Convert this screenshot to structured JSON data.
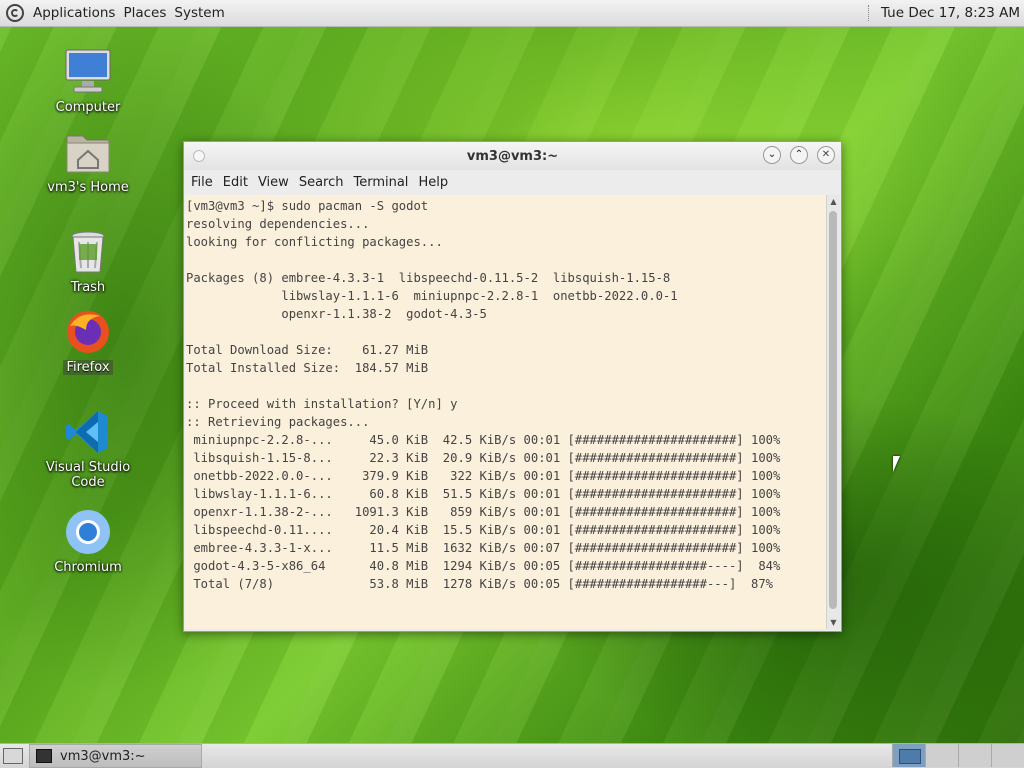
{
  "top_panel": {
    "menus": [
      "Applications",
      "Places",
      "System"
    ],
    "clock": "Tue Dec 17,  8:23 AM"
  },
  "desktop_icons": [
    {
      "label": "Computer",
      "icon": "computer-icon"
    },
    {
      "label": "vm3's Home",
      "icon": "home-folder-icon"
    },
    {
      "label": "Trash",
      "icon": "trash-icon"
    },
    {
      "label": "Firefox",
      "icon": "firefox-icon",
      "selected": true
    },
    {
      "label": "Visual Studio Code",
      "icon": "vscode-icon"
    },
    {
      "label": "Chromium",
      "icon": "chromium-icon"
    }
  ],
  "window": {
    "title": "vm3@vm3:~",
    "menus": [
      "File",
      "Edit",
      "View",
      "Search",
      "Terminal",
      "Help"
    ],
    "terminal_lines": [
      "[vm3@vm3 ~]$ sudo pacman -S godot",
      "resolving dependencies...",
      "looking for conflicting packages...",
      "",
      "Packages (8) embree-4.3.3-1  libspeechd-0.11.5-2  libsquish-1.15-8",
      "             libwslay-1.1.1-6  miniupnpc-2.2.8-1  onetbb-2022.0.0-1",
      "             openxr-1.1.38-2  godot-4.3-5",
      "",
      "Total Download Size:    61.27 MiB",
      "Total Installed Size:  184.57 MiB",
      "",
      ":: Proceed with installation? [Y/n] y",
      ":: Retrieving packages...",
      " miniupnpc-2.2.8-...     45.0 KiB  42.5 KiB/s 00:01 [######################] 100%",
      " libsquish-1.15-8...     22.3 KiB  20.9 KiB/s 00:01 [######################] 100%",
      " onetbb-2022.0.0-...    379.9 KiB   322 KiB/s 00:01 [######################] 100%",
      " libwslay-1.1.1-6...     60.8 KiB  51.5 KiB/s 00:01 [######################] 100%",
      " openxr-1.1.38-2-...   1091.3 KiB   859 KiB/s 00:01 [######################] 100%",
      " libspeechd-0.11....     20.4 KiB  15.5 KiB/s 00:01 [######################] 100%",
      " embree-4.3.3-1-x...     11.5 MiB  1632 KiB/s 00:07 [######################] 100%",
      " godot-4.3-5-x86_64      40.8 MiB  1294 KiB/s 00:05 [##################----]  84%",
      " Total (7/8)             53.8 MiB  1278 KiB/s 00:05 [##################---]  87%"
    ]
  },
  "taskbar": {
    "task_label": "vm3@vm3:~"
  }
}
